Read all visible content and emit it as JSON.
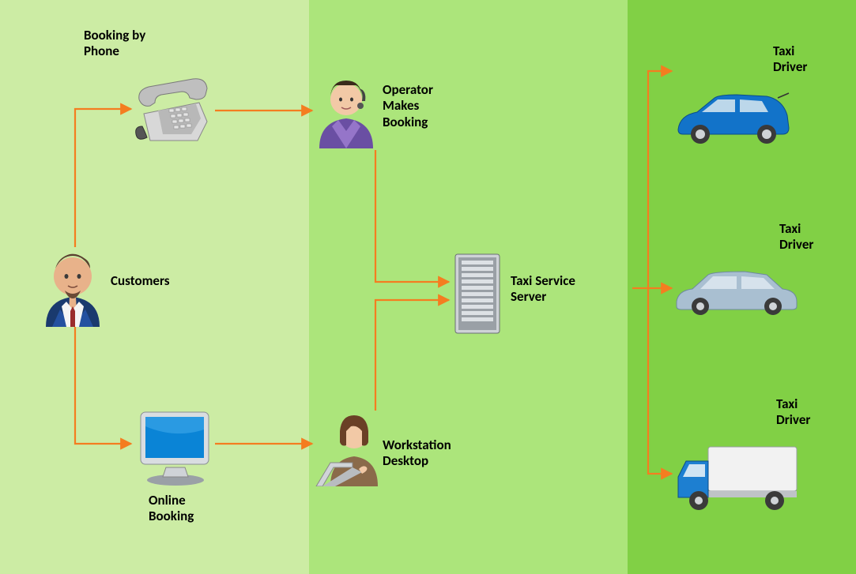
{
  "diagram": {
    "lanes": [
      {
        "id": "lane1",
        "color": "#cceca4"
      },
      {
        "id": "lane2",
        "color": "#ace57b"
      },
      {
        "id": "lane3",
        "color": "#81d045"
      }
    ],
    "nodes": {
      "customer": {
        "label": "Customers"
      },
      "phone": {
        "label": "Booking by\nPhone"
      },
      "online": {
        "label": "Online\nBooking"
      },
      "operator": {
        "label": "Operator\nMakes\nBooking"
      },
      "workstation": {
        "label": "Workstation\nDesktop"
      },
      "server": {
        "label": "Taxi Service\nServer"
      },
      "driver1": {
        "label": "Taxi\nDriver"
      },
      "driver2": {
        "label": "Taxi\nDriver"
      },
      "driver3": {
        "label": "Taxi\nDriver"
      }
    },
    "edges": [
      [
        "customer",
        "phone"
      ],
      [
        "customer",
        "online"
      ],
      [
        "phone",
        "operator"
      ],
      [
        "online",
        "workstation"
      ],
      [
        "operator",
        "server"
      ],
      [
        "workstation",
        "server"
      ],
      [
        "server",
        "driver1"
      ],
      [
        "server",
        "driver2"
      ],
      [
        "server",
        "driver3"
      ]
    ],
    "arrow_color": "#f47d20"
  }
}
